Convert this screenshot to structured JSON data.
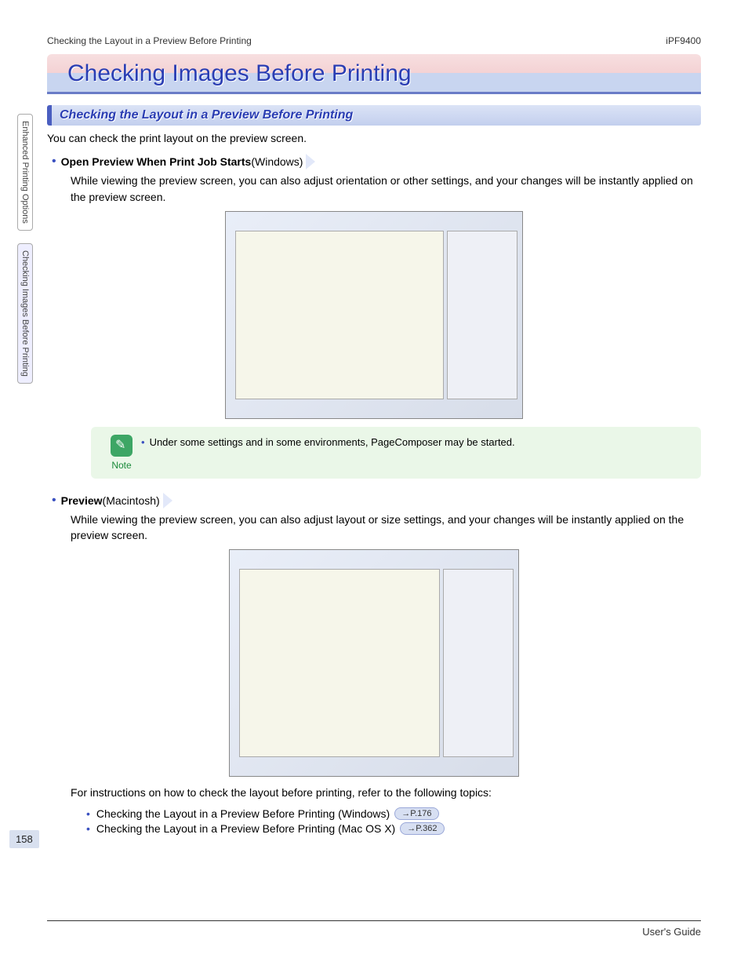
{
  "header": {
    "left": "Checking the Layout in a Preview Before Printing",
    "right": "iPF9400"
  },
  "sidebar": {
    "tab1": "Enhanced Printing Options",
    "tab2": "Checking Images Before Printing"
  },
  "page_number": "158",
  "chapter_title": "Checking Images Before Printing",
  "section_title": "Checking the Layout in a Preview Before Printing",
  "intro": "You can check the print layout on the preview screen.",
  "feature_win": {
    "label": "Open Preview When Print Job Starts",
    "os": " (Windows)"
  },
  "text_win": "While viewing the preview screen, you can also adjust orientation or other settings, and your changes will be instantly applied on the preview screen.",
  "note": {
    "label": "Note",
    "text": "Under some settings and in some environments, PageComposer may be started."
  },
  "feature_mac": {
    "label": "Preview",
    "os": " (Macintosh)"
  },
  "text_mac": "While viewing the preview screen, you can also adjust layout or size settings, and your changes will be instantly applied on the preview screen.",
  "ref_intro": "For instructions on how to check the layout before printing, refer to the following topics:",
  "refs": [
    {
      "text": "Checking the Layout in a Preview Before Printing (Windows)",
      "page": "→P.176"
    },
    {
      "text": "Checking the Layout in a Preview Before Printing (Mac OS X)",
      "page": "→P.362"
    }
  ],
  "footer": "User's Guide"
}
